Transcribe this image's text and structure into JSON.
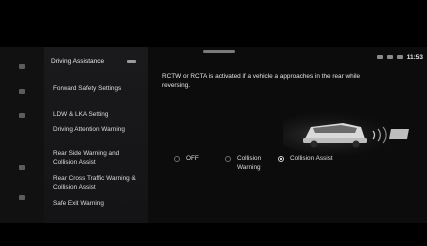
{
  "status": {
    "clock": "11:53"
  },
  "menu": {
    "header": "Driving Assistance",
    "items": [
      {
        "label": "Forward Safety Settings"
      },
      {
        "label": "LDW & LKA Setting"
      },
      {
        "label": "Driving Attention Warning"
      },
      {
        "label": "Rear Side Warning and Collision Assist"
      },
      {
        "label": "Rear Cross Traffic Warning & Collision Assist"
      },
      {
        "label": "Safe Exit Warning"
      }
    ]
  },
  "content": {
    "description": "RCTW or RCTA is activated if a vehicle a approaches in the rear while reversing.",
    "options": [
      {
        "label": "OFF",
        "selected": false
      },
      {
        "label": "Collision Warning",
        "selected": false
      },
      {
        "label": "Collision Assist",
        "selected": true
      }
    ]
  },
  "icons": {
    "rail": [
      "home-icon",
      "navigation-icon",
      "media-icon",
      "phone-icon",
      "settings-icon"
    ],
    "menu_header": "toggle-icon",
    "illustration": "rear-cross-traffic-car-icon"
  },
  "colors": {
    "background": "#000000",
    "screen": "#0c0c0d",
    "menu_panel": "#1a1a1c",
    "text": "#e8e8e8"
  }
}
